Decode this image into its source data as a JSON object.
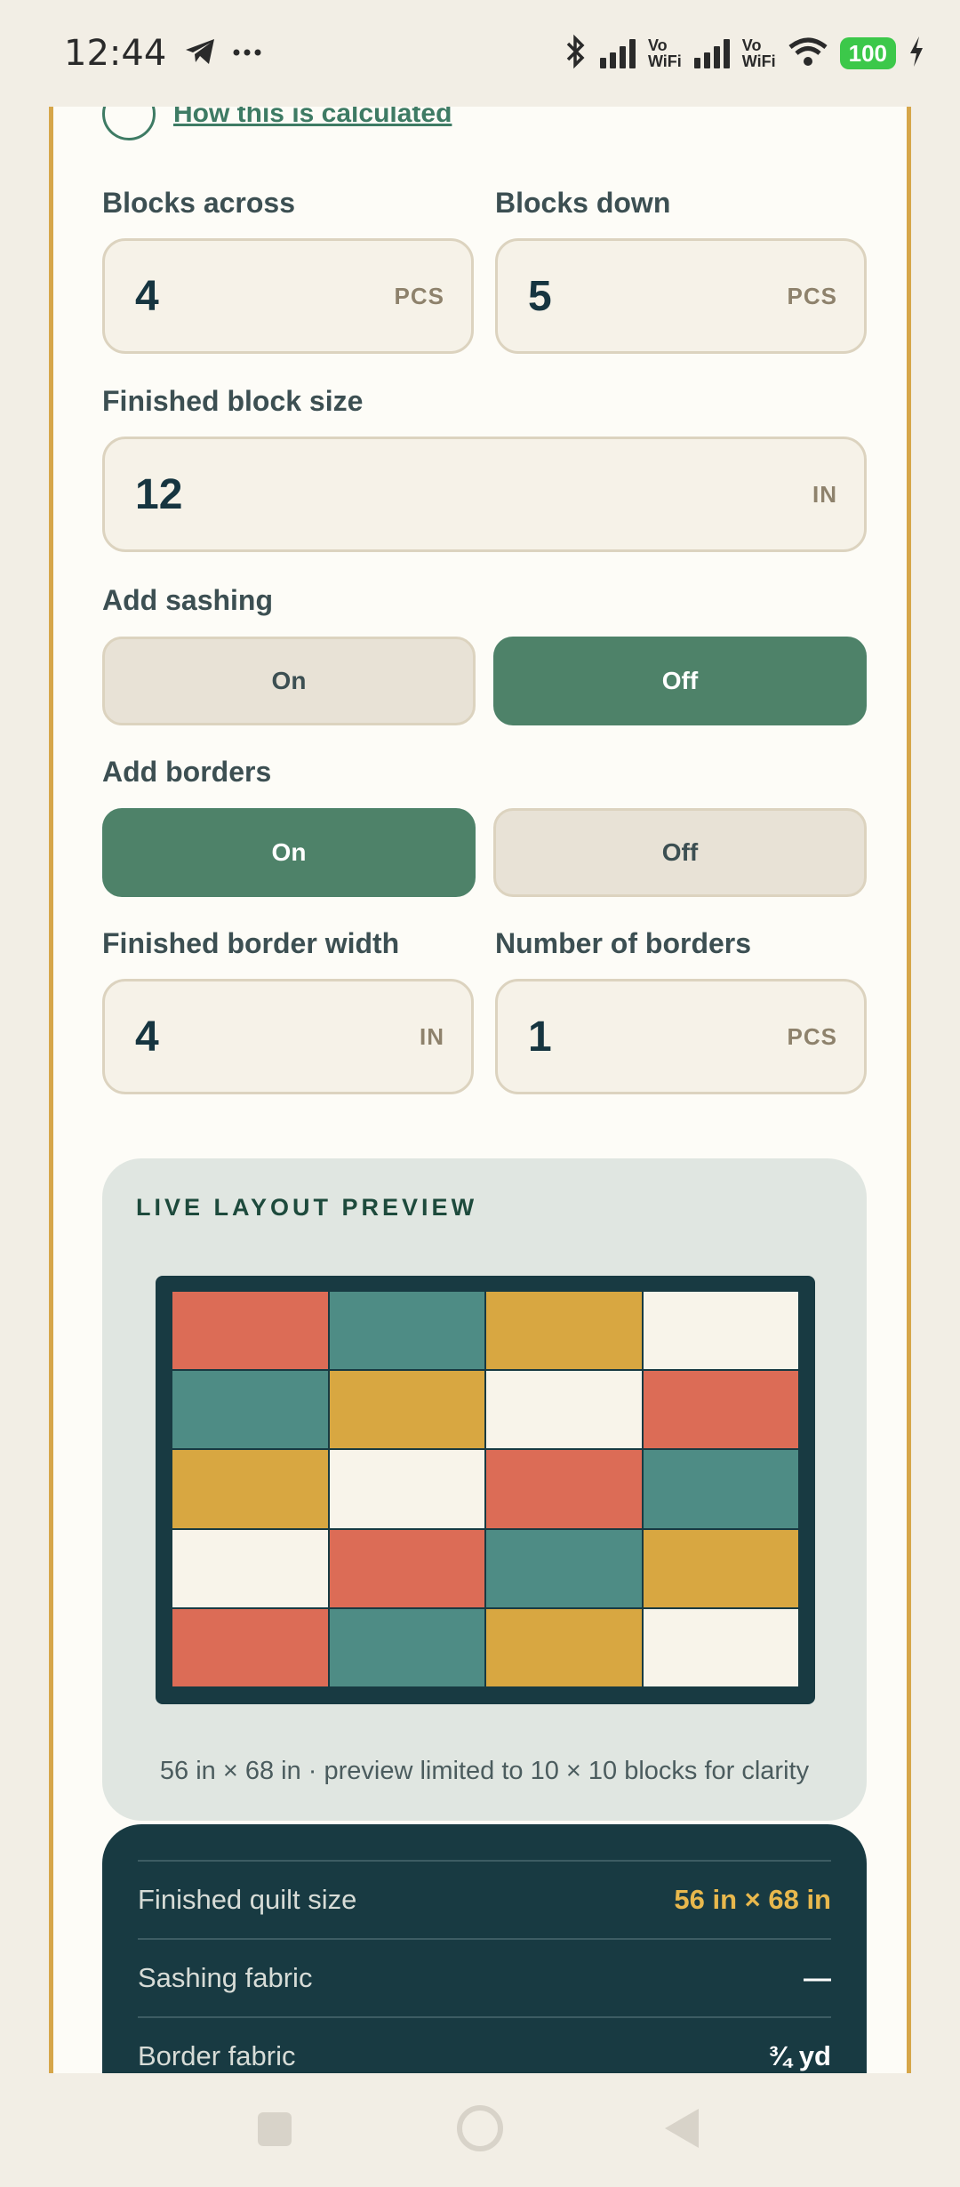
{
  "status_bar": {
    "time": "12:44",
    "left_icons": [
      "telegram-icon",
      "more-icon"
    ],
    "vowifi_label_top": "Vo",
    "vowifi_label_bottom": "WiFi",
    "battery": "100"
  },
  "calc_link": {
    "label": "How this is calculated"
  },
  "fields": {
    "blocks_across": {
      "label": "Blocks across",
      "value": "4",
      "unit": "PCS"
    },
    "blocks_down": {
      "label": "Blocks down",
      "value": "5",
      "unit": "PCS"
    },
    "block_size": {
      "label": "Finished block size",
      "value": "12",
      "unit": "IN"
    },
    "border_width": {
      "label": "Finished border width",
      "value": "4",
      "unit": "IN"
    },
    "border_count": {
      "label": "Number of borders",
      "value": "1",
      "unit": "PCS"
    }
  },
  "sashing": {
    "label": "Add sashing",
    "on": "On",
    "off": "Off",
    "selected": "off"
  },
  "borders": {
    "label": "Add borders",
    "on": "On",
    "off": "Off",
    "selected": "on"
  },
  "preview": {
    "title": "LIVE LAYOUT PREVIEW",
    "caption": "56 in × 68 in · preview limited to 10 × 10 blocks for clarity",
    "colors": {
      "coral": "#dc6c56",
      "teal": "#4e8c85",
      "gold": "#d8a741",
      "cream": "#f8f4ea",
      "frame": "#183a42"
    },
    "grid": [
      [
        "coral",
        "teal",
        "gold",
        "cream"
      ],
      [
        "teal",
        "gold",
        "cream",
        "coral"
      ],
      [
        "gold",
        "cream",
        "coral",
        "teal"
      ],
      [
        "cream",
        "coral",
        "teal",
        "gold"
      ],
      [
        "coral",
        "teal",
        "gold",
        "cream"
      ]
    ]
  },
  "results": [
    {
      "label": "Finished quilt size",
      "value": "56 in × 68 in",
      "accent": true
    },
    {
      "label": "Sashing fabric",
      "value": "—",
      "accent": false
    },
    {
      "label": "Border fabric",
      "value": "¾ yd",
      "accent": false
    }
  ],
  "nav": {
    "icons": [
      "recents-icon",
      "home-icon",
      "back-icon"
    ]
  }
}
